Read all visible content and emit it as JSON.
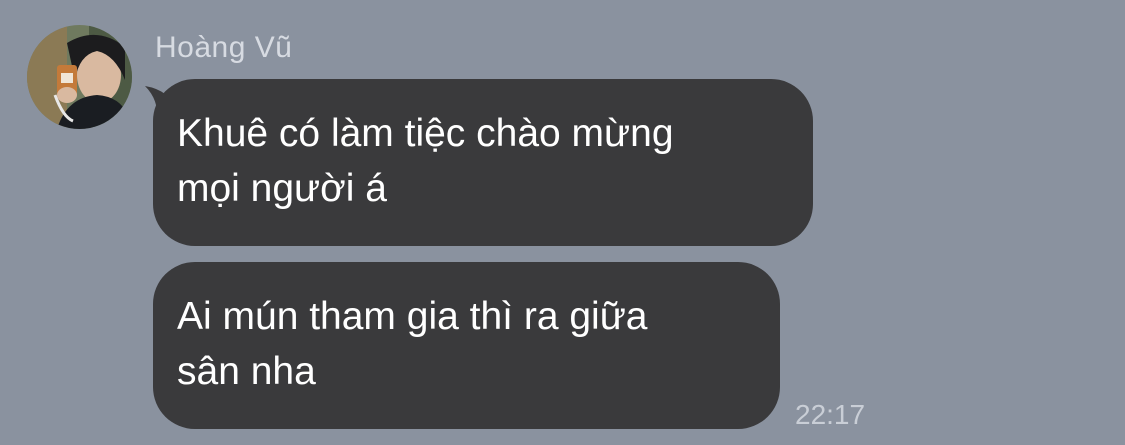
{
  "theme": {
    "background": "#8a929f",
    "bubble_bg": "#3a3a3c",
    "bubble_text": "#ffffff",
    "name_color": "#d7dbe2",
    "timestamp_color": "#c9ced6"
  },
  "sender": {
    "name": "Hoàng Vũ",
    "avatar_icon": "avatar-photo"
  },
  "messages": [
    {
      "text": "Khuê có làm tiệc chào mừng\nmọi người á"
    },
    {
      "text": "Ai mún tham gia thì ra giữa\nsân nha"
    }
  ],
  "timestamp": "22:17"
}
